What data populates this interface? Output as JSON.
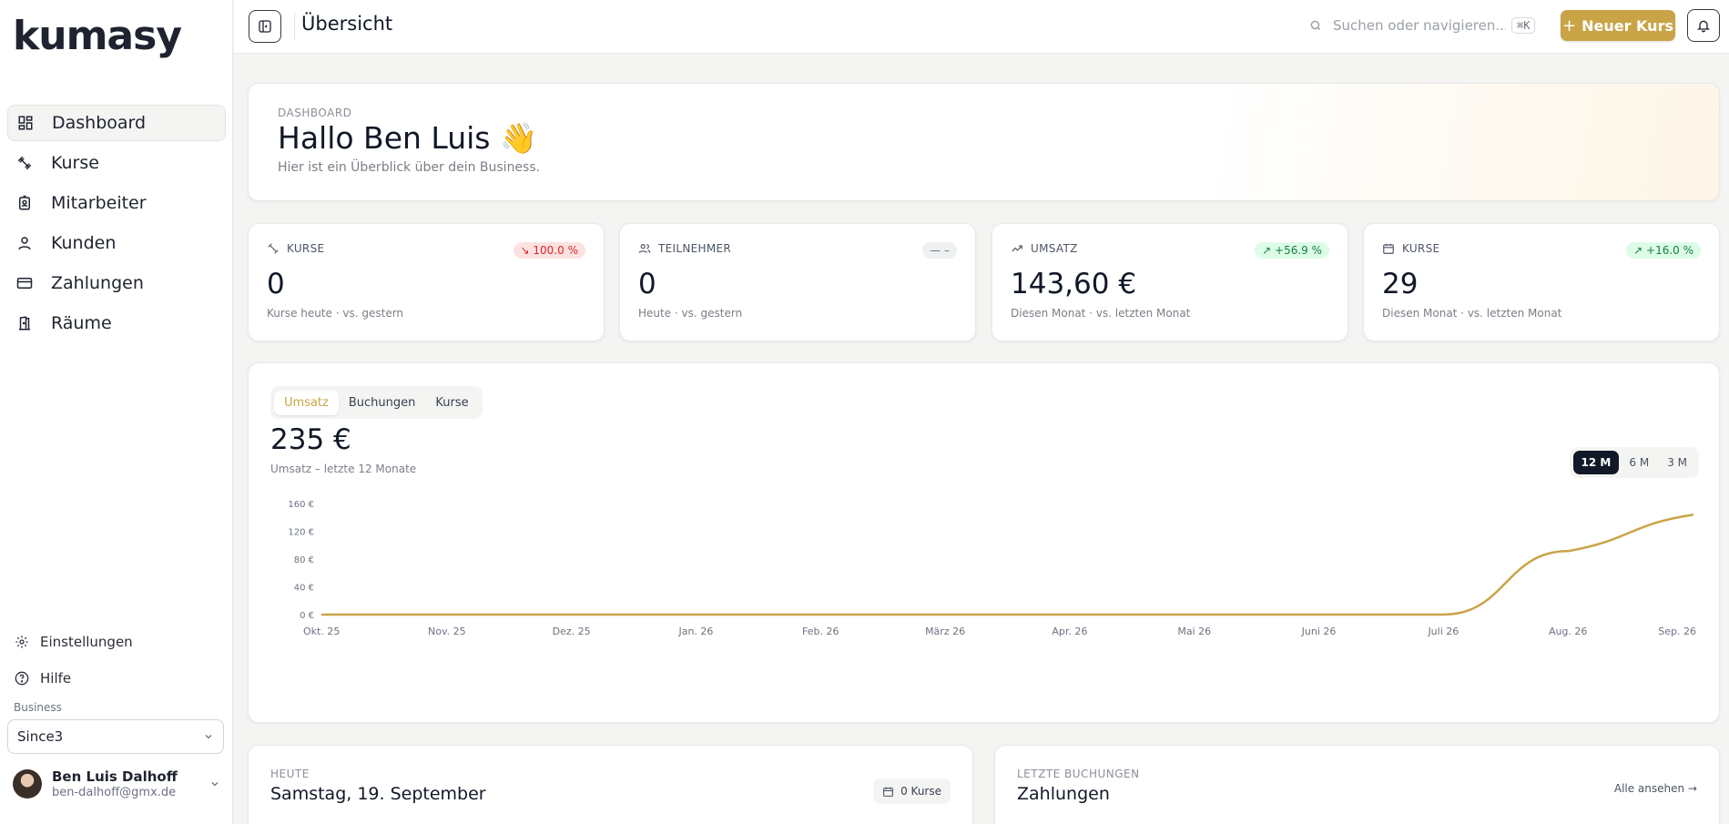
{
  "brand": {
    "logo_text": "kumasy",
    "accent": "#c9a447"
  },
  "sidebar": {
    "items": [
      {
        "label": "Dashboard",
        "icon": "dashboard-icon",
        "active": true
      },
      {
        "label": "Kurse",
        "icon": "dumbbell-icon"
      },
      {
        "label": "Mitarbeiter",
        "icon": "badge-icon"
      },
      {
        "label": "Kunden",
        "icon": "user-icon"
      },
      {
        "label": "Zahlungen",
        "icon": "credit-card-icon"
      },
      {
        "label": "Räume",
        "icon": "door-icon"
      }
    ],
    "settings_label": "Einstellungen",
    "help_label": "Hilfe",
    "business_label": "Business",
    "business_value": "Since3",
    "user": {
      "name": "Ben Luis Dalhoff",
      "email": "ben-dalhoff@gmx.de"
    }
  },
  "topbar": {
    "title": "Übersicht",
    "search_placeholder": "Suchen oder navigieren...",
    "search_shortcut": "⌘K",
    "new_button": "Neuer Kurs"
  },
  "hero": {
    "eyebrow": "DASHBOARD",
    "greeting": "Hallo Ben Luis 👋",
    "subtitle": "Hier ist ein Überblick über dein Business."
  },
  "stats": [
    {
      "label": "KURSE",
      "value": "0",
      "caption": "Kurse heute · vs. gestern",
      "badge": "↘ 100.0 %",
      "trend": "neg"
    },
    {
      "label": "TEILNEHMER",
      "value": "0",
      "caption": "Heute · vs. gestern",
      "badge": "— –",
      "trend": "neu"
    },
    {
      "label": "UMSATZ",
      "value": "143,60 €",
      "caption": "Diesen Monat · vs. letzten Monat",
      "badge": "↗ +56.9 %",
      "trend": "pos"
    },
    {
      "label": "KURSE",
      "value": "29",
      "caption": "Diesen Monat · vs. letzten Monat",
      "badge": "↗ +16.0 %",
      "trend": "pos"
    }
  ],
  "chart_panel": {
    "tabs": [
      "Umsatz",
      "Buchungen",
      "Kurse"
    ],
    "active_tab": "Umsatz",
    "total": "235 €",
    "subtitle": "Umsatz – letzte 12 Monate",
    "ranges": [
      "12 M",
      "6 M",
      "3 M"
    ],
    "active_range": "12 M"
  },
  "chart_data": {
    "type": "line",
    "categories": [
      "Okt. 25",
      "Nov. 25",
      "Dez. 25",
      "Jan. 26",
      "Feb. 26",
      "März 26",
      "Apr. 26",
      "Mai 26",
      "Juni 26",
      "Juli 26",
      "Aug. 26",
      "Sep. 26"
    ],
    "series": [
      {
        "values": [
          0,
          0,
          0,
          0,
          0,
          0,
          0,
          0,
          0,
          0,
          91.4,
          143.6
        ]
      }
    ],
    "y_ticks": [
      "0 €",
      "40 €",
      "80 €",
      "120 €",
      "160 €"
    ],
    "ylim": [
      0,
      160
    ],
    "line_color": "#c9a447",
    "grid": false
  },
  "today": {
    "eyebrow": "HEUTE",
    "title": "Samstag, 19. September",
    "chip": "0 Kurse"
  },
  "bookings": {
    "eyebrow": "LETZTE BUCHUNGEN",
    "title": "Zahlungen",
    "link": "Alle ansehen →"
  }
}
